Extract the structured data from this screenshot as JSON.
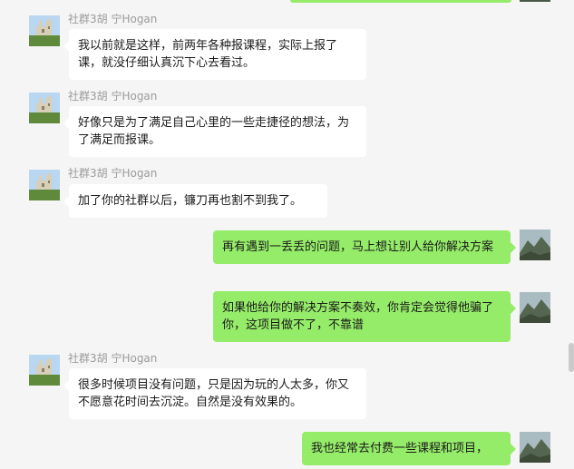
{
  "conversation": {
    "messages": [
      {
        "side": "in",
        "sender": "社群3胡 宁Hogan",
        "text": "我以前就是这样，前两年各种报课程，实际上报了课，就没仔细认真沉下心去看过。"
      },
      {
        "side": "in",
        "sender": "社群3胡 宁Hogan",
        "text": "好像只是为了满足自己心里的一些走捷径的想法，为了满足而报课。"
      },
      {
        "side": "in",
        "sender": "社群3胡 宁Hogan",
        "text": "加了你的社群以后，镰刀再也割不到我了。"
      },
      {
        "side": "out",
        "text": "再有遇到一丢丢的问题，马上想让别人给你解决方案"
      },
      {
        "side": "out",
        "text": "如果他给你的解决方案不奏效，你肯定会觉得他骗了你，这项目做不了，不靠谱"
      },
      {
        "side": "in",
        "sender": "社群3胡 宁Hogan",
        "text": "很多时候项目没有问题，只是因为玩的人太多，你又不愿意花时间去沉淀。自然是没有效果的。"
      },
      {
        "side": "out",
        "text": "我也经常去付费一些课程和项目，"
      }
    ]
  },
  "colors": {
    "background": "#f5f5f5",
    "incoming_bubble": "#ffffff",
    "outgoing_bubble": "#95ec69",
    "sender_name": "#9a9a9a"
  },
  "icons": {
    "incoming_avatar": "castle-photo-avatar",
    "outgoing_avatar": "mountain-photo-avatar"
  }
}
